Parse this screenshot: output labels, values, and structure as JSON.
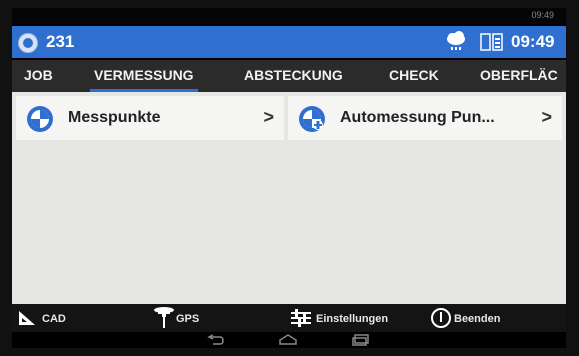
{
  "statusbar": {
    "time": "09:49"
  },
  "appbar": {
    "count": "231",
    "time": "09:49"
  },
  "tabs": [
    {
      "label": "JOB"
    },
    {
      "label": "VERMESSUNG"
    },
    {
      "label": "ABSTECKUNG"
    },
    {
      "label": "CHECK"
    },
    {
      "label": "OBERFLÄC"
    }
  ],
  "cards": [
    {
      "label": "Messpunkte",
      "chevron": ">"
    },
    {
      "label": "Automessung Pun...",
      "chevron": ">"
    }
  ],
  "bottombar": {
    "cad": "CAD",
    "gps": "GPS",
    "settings": "Einstellungen",
    "exit": "Beenden"
  },
  "colors": {
    "accent": "#2f6fd0",
    "tabbar": "#2b2b2b",
    "content": "#e6e6e4"
  }
}
